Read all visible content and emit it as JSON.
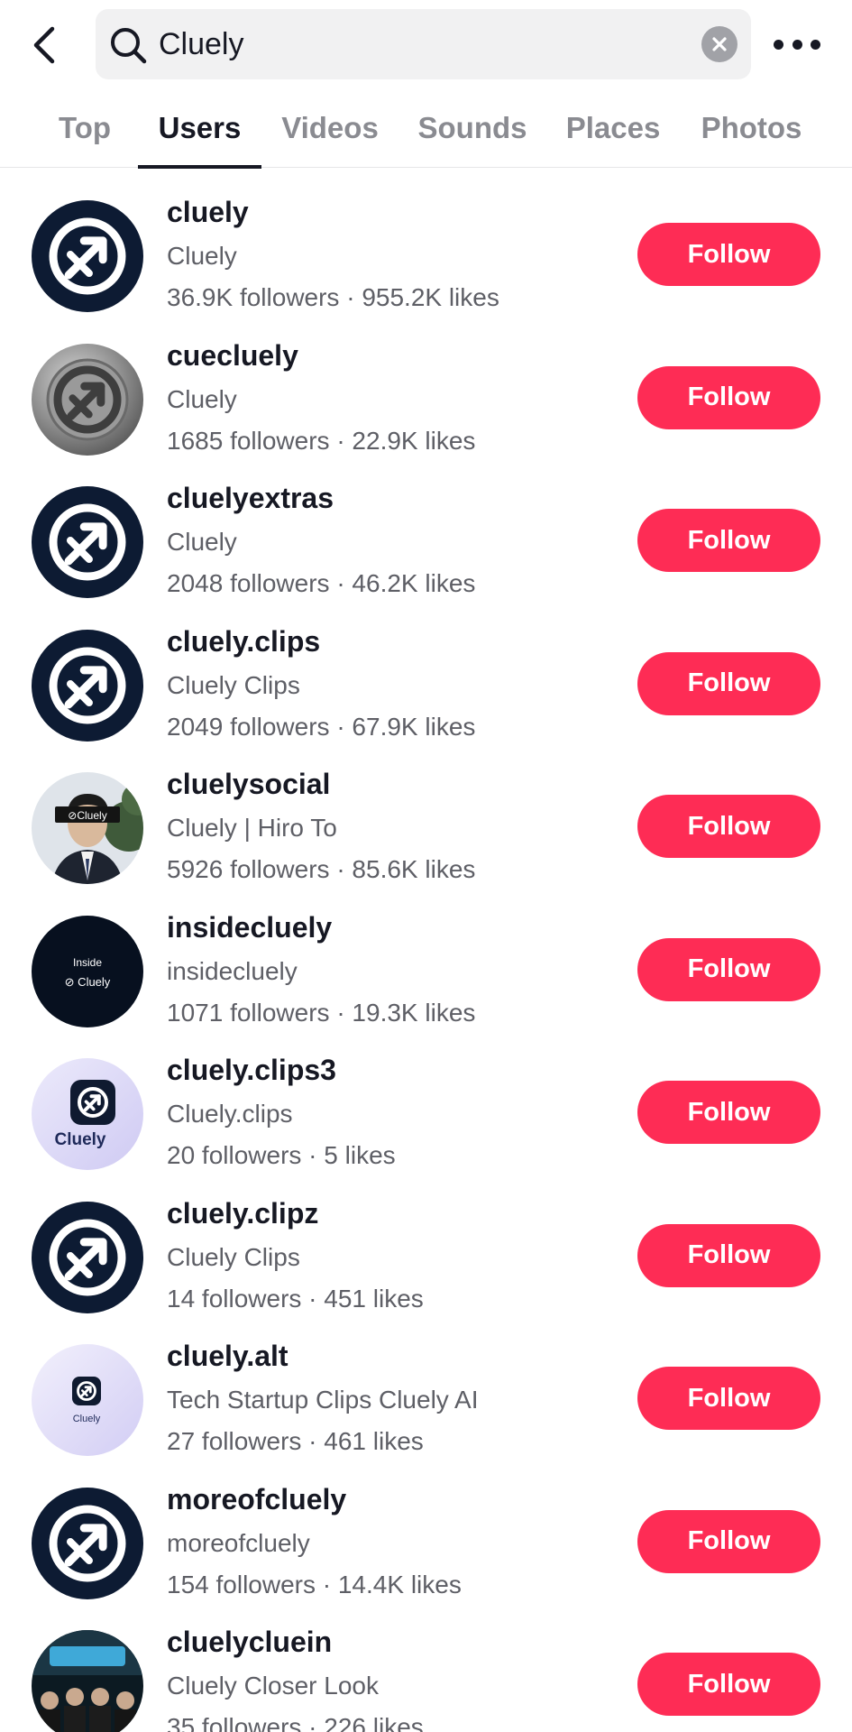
{
  "header": {
    "back_icon": "chevron-left-icon",
    "search_value": "Cluely",
    "search_icon": "search-icon",
    "clear_icon": "clear-icon",
    "more_icon": "more-horizontal-icon"
  },
  "tabs": [
    {
      "label": "Top",
      "active": false
    },
    {
      "label": "Users",
      "active": true
    },
    {
      "label": "Videos",
      "active": false
    },
    {
      "label": "Sounds",
      "active": false
    },
    {
      "label": "Places",
      "active": false
    },
    {
      "label": "Photos",
      "active": false
    }
  ],
  "colors": {
    "accent": "#fe2c55",
    "logo_navy": "#0d1b33",
    "logo_lavender": "#dcd9f7"
  },
  "users": [
    {
      "username": "cluely",
      "nickname": "Cluely",
      "stats": "36.9K followers · 955.2K likes",
      "follow_label": "Follow",
      "avatar": "navy-logo"
    },
    {
      "username": "cuecluely",
      "nickname": "Cluely",
      "stats": "1685 followers · 22.9K likes",
      "follow_label": "Follow",
      "avatar": "metal-logo"
    },
    {
      "username": "cluelyextras",
      "nickname": "Cluely",
      "stats": "2048 followers · 46.2K likes",
      "follow_label": "Follow",
      "avatar": "navy-logo"
    },
    {
      "username": "cluely.clips",
      "nickname": "Cluely Clips",
      "stats": "2049 followers · 67.9K likes",
      "follow_label": "Follow",
      "avatar": "navy-logo"
    },
    {
      "username": "cluelysocial",
      "nickname": "Cluely | Hiro To",
      "stats": "5926 followers · 85.6K likes",
      "follow_label": "Follow",
      "avatar": "photo-person",
      "avatar_text": "Cluely"
    },
    {
      "username": "insidecluely",
      "nickname": "insidecluely",
      "stats": "1071 followers · 19.3K likes",
      "follow_label": "Follow",
      "avatar": "dark-inside",
      "avatar_text_top": "Inside",
      "avatar_text": "Cluely"
    },
    {
      "username": "cluely.clips3",
      "nickname": "Cluely.clips",
      "stats": "20 followers · 5 likes",
      "follow_label": "Follow",
      "avatar": "lavender-app",
      "avatar_text": "Cluely"
    },
    {
      "username": "cluely.clipz",
      "nickname": "Cluely Clips",
      "stats": "14 followers · 451 likes",
      "follow_label": "Follow",
      "avatar": "navy-logo"
    },
    {
      "username": "cluely.alt",
      "nickname": "Tech Startup Clips Cluely AI",
      "stats": "27 followers · 461 likes",
      "follow_label": "Follow",
      "avatar": "lavender-small",
      "avatar_text": "Cluely"
    },
    {
      "username": "moreofcluely",
      "nickname": "moreofcluely",
      "stats": "154 followers · 14.4K likes",
      "follow_label": "Follow",
      "avatar": "navy-logo"
    },
    {
      "username": "cluelycluein",
      "nickname": "Cluely Closer Look",
      "stats": "35 followers · 226 likes",
      "follow_label": "Follow",
      "avatar": "photo-group"
    }
  ]
}
